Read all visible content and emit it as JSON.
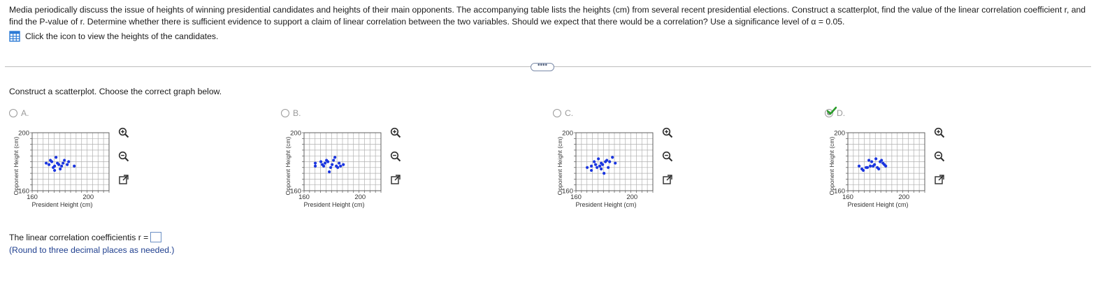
{
  "question": {
    "text": "Media periodically discuss the issue of heights of winning presidential candidates and heights of their main opponents. The accompanying table lists the heights (cm) from several recent presidential elections. Construct a scatterplot, find the value of the linear correlation coefficient r, and find the P-value of r. Determine whether there is sufficient evidence to support a claim of linear correlation between the two variables. Should we expect that there would be a correlation? Use a significance level of α = 0.05.",
    "view_data_label": "Click the icon to view the heights of the candidates.",
    "table_icon": "table-icon"
  },
  "expander_label": "••••",
  "part1": {
    "prompt": "Construct a scatterplot. Choose the correct graph below.",
    "options": [
      {
        "label": "A.",
        "selected": false,
        "correct": false
      },
      {
        "label": "B.",
        "selected": false,
        "correct": false
      },
      {
        "label": "C.",
        "selected": false,
        "correct": false
      },
      {
        "label": "D.",
        "selected": true,
        "correct": true
      }
    ],
    "plot_labels": {
      "ylabel": "Opponent Height (cm)",
      "xlabel": "President Height (cm)",
      "y_ticks": [
        "200",
        "160"
      ],
      "x_ticks": [
        "160",
        "200"
      ]
    },
    "plot_controls": [
      "zoom-in-icon",
      "zoom-out-icon",
      "pop-out-icon"
    ],
    "colors": {
      "points": "#1a35e0",
      "grid": "#b0b0b0",
      "check": "#2a9d2a",
      "answer_blue": "#1f3f8f"
    }
  },
  "part2": {
    "label": "The linear correlation coefficientis r =",
    "value": "",
    "hint": "(Round to three decimal places as needed.)"
  },
  "chart_data": [
    {
      "type": "scatter",
      "label": "A",
      "xlabel": "President Height (cm)",
      "ylabel": "Opponent Height (cm)",
      "xlim": [
        160,
        200
      ],
      "ylim": [
        160,
        200
      ],
      "x": [
        170,
        172,
        173,
        174,
        175,
        176,
        176,
        177,
        178,
        179,
        180,
        181,
        182,
        183,
        185,
        186,
        190
      ],
      "y": [
        179,
        178,
        181,
        180,
        176,
        177,
        174,
        183,
        179,
        178,
        175,
        177,
        179,
        181,
        178,
        180,
        177
      ]
    },
    {
      "type": "scatter",
      "label": "B",
      "xlabel": "President Height (cm)",
      "ylabel": "Opponent Height (cm)",
      "xlim": [
        160,
        200
      ],
      "ylim": [
        160,
        200
      ],
      "x": [
        168,
        168,
        172,
        173,
        174,
        175,
        176,
        177,
        178,
        179,
        180,
        181,
        182,
        183,
        184,
        185,
        186,
        188
      ],
      "y": [
        179,
        177,
        180,
        178,
        177,
        179,
        181,
        180,
        173,
        176,
        178,
        181,
        183,
        177,
        176,
        179,
        177,
        178
      ]
    },
    {
      "type": "scatter",
      "label": "C",
      "xlabel": "President Height (cm)",
      "ylabel": "Opponent Height (cm)",
      "xlim": [
        160,
        200
      ],
      "ylim": [
        160,
        200
      ],
      "x": [
        168,
        171,
        171,
        173,
        174,
        175,
        176,
        177,
        178,
        178,
        179,
        180,
        181,
        182,
        183,
        184,
        186,
        188
      ],
      "y": [
        176,
        177,
        174,
        180,
        178,
        176,
        182,
        177,
        179,
        175,
        178,
        172,
        180,
        181,
        176,
        180,
        183,
        179
      ]
    },
    {
      "type": "scatter",
      "label": "D",
      "xlabel": "President Height (cm)",
      "ylabel": "Opponent Height (cm)",
      "xlim": [
        160,
        200
      ],
      "ylim": [
        160,
        200
      ],
      "x": [
        168,
        170,
        171,
        173,
        174,
        175,
        176,
        177,
        178,
        179,
        180,
        181,
        182,
        183,
        184,
        185,
        186,
        187
      ],
      "y": [
        177,
        175,
        174,
        176,
        176,
        181,
        177,
        180,
        177,
        178,
        182,
        176,
        175,
        180,
        181,
        179,
        178,
        177
      ]
    }
  ]
}
